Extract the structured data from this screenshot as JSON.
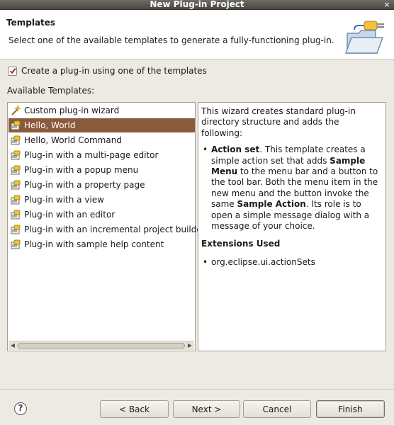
{
  "window": {
    "title": "New Plug-in Project",
    "close_glyph": "×"
  },
  "header": {
    "title": "Templates",
    "description": "Select one of the available templates to generate a fully-functioning plug-in.",
    "icon": "plugin-folder-icon"
  },
  "create_checkbox": {
    "checked": true,
    "label": "Create a plug-in using one of the templates"
  },
  "available_label": "Available Templates:",
  "templates": [
    {
      "label": "Custom plug-in wizard",
      "icon": "wizard-wand-icon"
    },
    {
      "label": "Hello, World",
      "icon": "template-icon",
      "selected": true
    },
    {
      "label": "Hello, World Command",
      "icon": "template-icon"
    },
    {
      "label": "Plug-in with a multi-page editor",
      "icon": "template-icon"
    },
    {
      "label": "Plug-in with a popup menu",
      "icon": "template-icon"
    },
    {
      "label": "Plug-in with a property page",
      "icon": "template-icon"
    },
    {
      "label": "Plug-in with a view",
      "icon": "template-icon"
    },
    {
      "label": "Plug-in with an editor",
      "icon": "template-icon"
    },
    {
      "label": "Plug-in with an incremental project builder",
      "icon": "template-icon"
    },
    {
      "label": "Plug-in with sample help content",
      "icon": "template-icon"
    }
  ],
  "description": {
    "intro": "This wizard creates standard plug-in directory structure and adds the following:",
    "bullet1": {
      "t1": "Action set",
      "t2": ". This template creates a simple action set that adds ",
      "t3": "Sample Menu",
      "t4": " to the menu bar and a button to the tool bar. Both the menu item in the new menu and the button invoke the same ",
      "t5": "Sample Action",
      "t6": ". Its role is to open a simple message dialog with a message of your choice."
    },
    "extensions_title": "Extensions Used",
    "extension": "org.eclipse.ui.actionSets"
  },
  "buttons": {
    "help": "?",
    "back": "< Back",
    "next": "Next >",
    "cancel": "Cancel",
    "finish": "Finish"
  },
  "colors": {
    "selection": "#8b5a3c",
    "background": "#ede9e3"
  }
}
